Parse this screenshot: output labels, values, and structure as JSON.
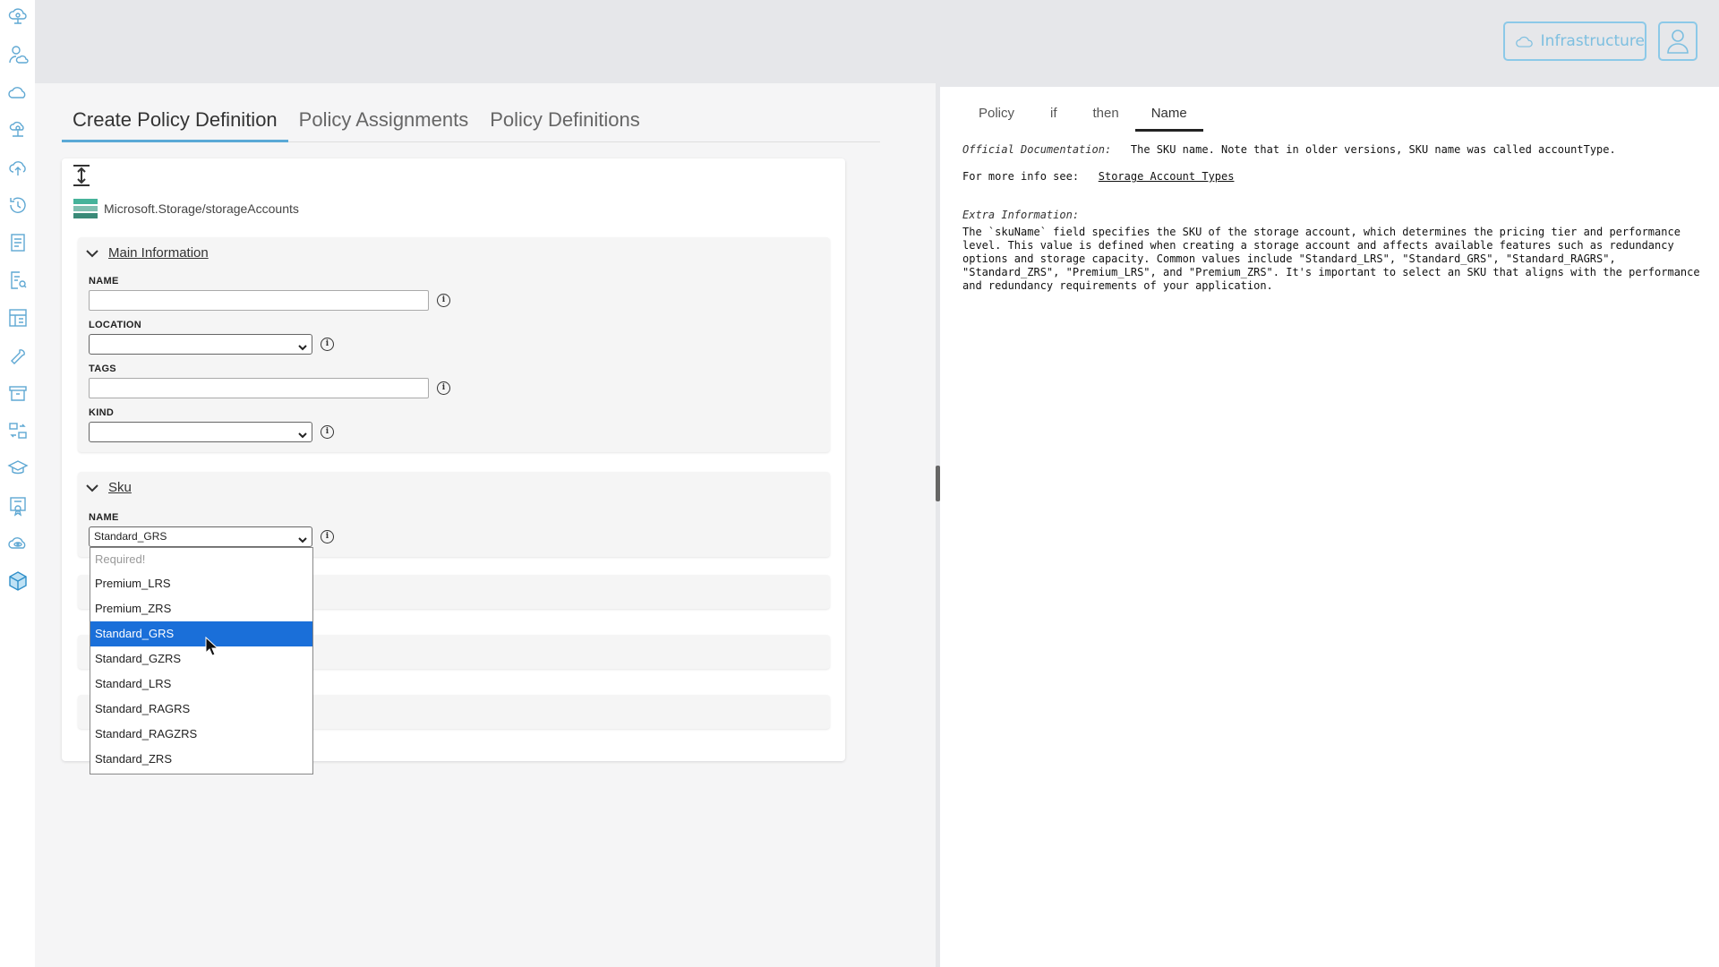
{
  "header": {
    "infrastructure_label": "Infrastructure"
  },
  "rail": {
    "icons": [
      "cloud-network-icon",
      "user-cloud-icon",
      "cloud-icon",
      "cloud-user-icon",
      "cloud-upload-icon",
      "history-icon",
      "document-icon",
      "document-search-icon",
      "dashboard-icon",
      "wrench-icon",
      "archive-icon",
      "swap-icon",
      "graduation-cap-icon",
      "certificate-icon",
      "cloud-eye-icon",
      "azure-box-icon"
    ]
  },
  "main": {
    "tabs": [
      {
        "label": "Create Policy Definition",
        "active": true
      },
      {
        "label": "Policy Assignments",
        "active": false
      },
      {
        "label": "Policy Definitions",
        "active": false
      }
    ],
    "resource_type": "Microsoft.Storage/storageAccounts",
    "main_section": {
      "title": "Main Information",
      "fields": {
        "name_label": "NAME",
        "name_value": "",
        "location_label": "LOCATION",
        "location_value": "",
        "tags_label": "TAGS",
        "tags_value": "",
        "kind_label": "KIND",
        "kind_value": ""
      }
    },
    "sku_section": {
      "title": "Sku",
      "name_label": "NAME",
      "name_value": "Standard_GRS",
      "options": [
        {
          "label": "Required!",
          "disabled": true
        },
        {
          "label": "Premium_LRS"
        },
        {
          "label": "Premium_ZRS"
        },
        {
          "label": "Standard_GRS",
          "selected": true
        },
        {
          "label": "Standard_GZRS"
        },
        {
          "label": "Standard_LRS"
        },
        {
          "label": "Standard_RAGRS"
        },
        {
          "label": "Standard_RAGZRS"
        },
        {
          "label": "Standard_ZRS"
        }
      ]
    },
    "info_glyph": "i"
  },
  "doc_panel": {
    "tabs": [
      {
        "label": "Policy",
        "active": false
      },
      {
        "label": "if",
        "active": false
      },
      {
        "label": "then",
        "active": false
      },
      {
        "label": "Name",
        "active": true
      }
    ],
    "official_label": "Official Documentation:",
    "official_text": "The SKU name. Note that in older versions, SKU name was called accountType.",
    "more_info_label": "For more info see:",
    "more_info_link": "Storage Account Types",
    "extra_label": "Extra Information:",
    "extra_text": "The `skuName` field specifies the SKU of the storage account, which determines the pricing tier and performance level. This value is defined when creating a storage account and affects available features such as redundancy options and storage capacity. Common values include \"Standard_LRS\", \"Standard_GRS\", \"Standard_RAGRS\", \"Standard_ZRS\", \"Premium_LRS\", and \"Premium_ZRS\". It's important to select an SKU that aligns with the performance and redundancy requirements of your application."
  },
  "colors": {
    "accent": "#5aa9d6",
    "selection": "#1a6fd9",
    "rail_icon": "#5fa8d3"
  }
}
